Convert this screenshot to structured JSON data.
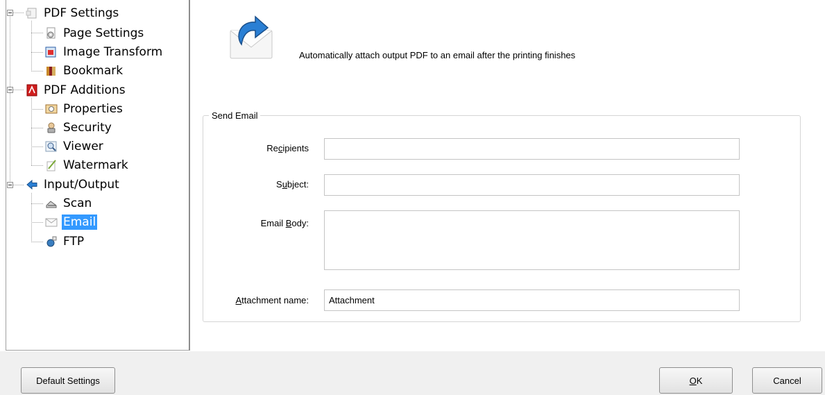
{
  "tree": {
    "items": [
      {
        "label": "PDF Settings",
        "icon": "pdf-settings-icon"
      },
      {
        "label": "Page Settings",
        "icon": "page-settings-icon"
      },
      {
        "label": "Image Transform",
        "icon": "image-transform-icon"
      },
      {
        "label": "Bookmark",
        "icon": "bookmark-icon"
      },
      {
        "label": "PDF Additions",
        "icon": "pdf-additions-icon"
      },
      {
        "label": "Properties",
        "icon": "properties-icon"
      },
      {
        "label": "Security",
        "icon": "security-icon"
      },
      {
        "label": "Viewer",
        "icon": "viewer-icon"
      },
      {
        "label": "Watermark",
        "icon": "watermark-icon"
      },
      {
        "label": "Input/Output",
        "icon": "input-output-icon"
      },
      {
        "label": "Scan",
        "icon": "scan-icon"
      },
      {
        "label": "Email",
        "icon": "email-icon",
        "selected": true
      },
      {
        "label": "FTP",
        "icon": "ftp-icon"
      }
    ]
  },
  "header": {
    "description": "Automatically attach output PDF to an email after the printing finishes"
  },
  "send_email": {
    "group_title": "Send Email",
    "recipients_label_pre": "Re",
    "recipients_label_acc": "c",
    "recipients_label_post": "ipients",
    "recipients_value": "",
    "subject_label_pre": "S",
    "subject_label_acc": "u",
    "subject_label_post": "bject:",
    "subject_value": "",
    "body_label_pre": "Email ",
    "body_label_acc": "B",
    "body_label_post": "ody:",
    "body_value": "",
    "attachment_label_acc": "A",
    "attachment_label_post": "ttachment name:",
    "attachment_value": "Attachment"
  },
  "buttons": {
    "default_settings": "Default Settings",
    "ok_acc": "O",
    "ok_post": "K",
    "cancel": "Cancel"
  },
  "colors": {
    "selection": "#3399ff",
    "panel_bg": "#f0f0f0"
  }
}
